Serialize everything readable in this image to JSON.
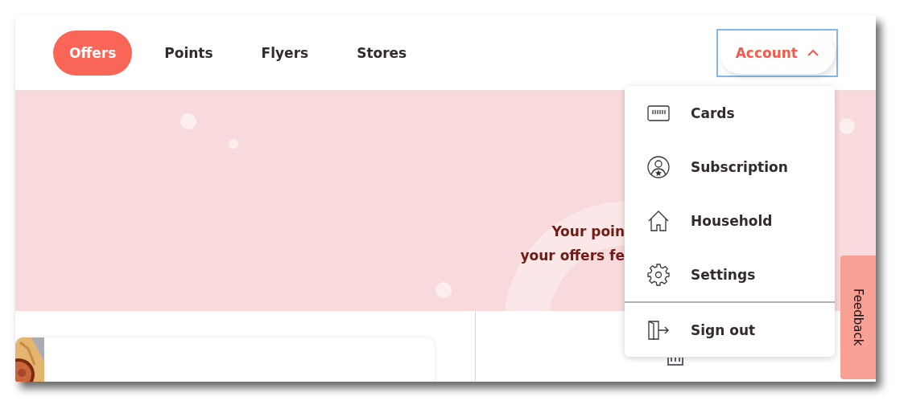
{
  "nav": {
    "tabs": [
      {
        "label": "Offers",
        "selected": true
      },
      {
        "label": "Points",
        "selected": false
      },
      {
        "label": "Flyers",
        "selected": false
      },
      {
        "label": "Stores",
        "selected": false
      }
    ]
  },
  "account_button": {
    "label": "Account",
    "expanded": true,
    "focused": true
  },
  "account_menu": {
    "groups": [
      [
        {
          "label": "Cards"
        },
        {
          "label": "Subscription"
        },
        {
          "label": "Household"
        },
        {
          "label": "Settings"
        }
      ],
      [
        {
          "label": "Sign out"
        }
      ]
    ]
  },
  "banner": {
    "lines": [
      "Your poin",
      "your offers fe"
    ]
  },
  "feedback_tab": {
    "label": "Feedback"
  }
}
